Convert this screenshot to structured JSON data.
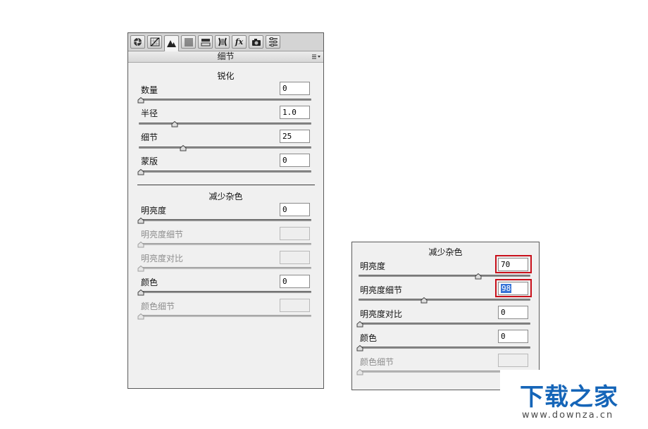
{
  "left_panel": {
    "title": "细节",
    "toolbar_icons": [
      "aperture-icon",
      "tone-curve-icon",
      "detail-icon",
      "hsl-icon",
      "split-toning-icon",
      "lens-correction-icon",
      "effects-icon",
      "camera-calibration-icon",
      "presets-icon"
    ],
    "effects_label": "fx",
    "sharpening": {
      "title": "锐化",
      "amount": {
        "label": "数量",
        "value": "0"
      },
      "radius": {
        "label": "半径",
        "value": "1.0"
      },
      "detail": {
        "label": "细节",
        "value": "25"
      },
      "masking": {
        "label": "蒙版",
        "value": "0"
      }
    },
    "noise_reduction": {
      "title": "减少杂色",
      "luminance": {
        "label": "明亮度",
        "value": "0"
      },
      "luminance_detail": {
        "label": "明亮度细节",
        "value": ""
      },
      "luminance_contrast": {
        "label": "明亮度对比",
        "value": ""
      },
      "color": {
        "label": "颜色",
        "value": "0"
      },
      "color_detail": {
        "label": "颜色细节",
        "value": ""
      }
    }
  },
  "right_panel": {
    "title": "减少杂色",
    "luminance": {
      "label": "明亮度",
      "value": "70"
    },
    "luminance_detail": {
      "label": "明亮度细节",
      "value": "98"
    },
    "luminance_contrast": {
      "label": "明亮度对比",
      "value": "0"
    },
    "color": {
      "label": "颜色",
      "value": "0"
    },
    "color_detail": {
      "label": "颜色细节",
      "value": ""
    }
  },
  "watermark": {
    "title": "下载之家",
    "url": "www.downza.cn"
  },
  "colors": {
    "highlight": "#c8101a",
    "watermark_blue": "#1565b8",
    "selection": "#3875d7"
  }
}
